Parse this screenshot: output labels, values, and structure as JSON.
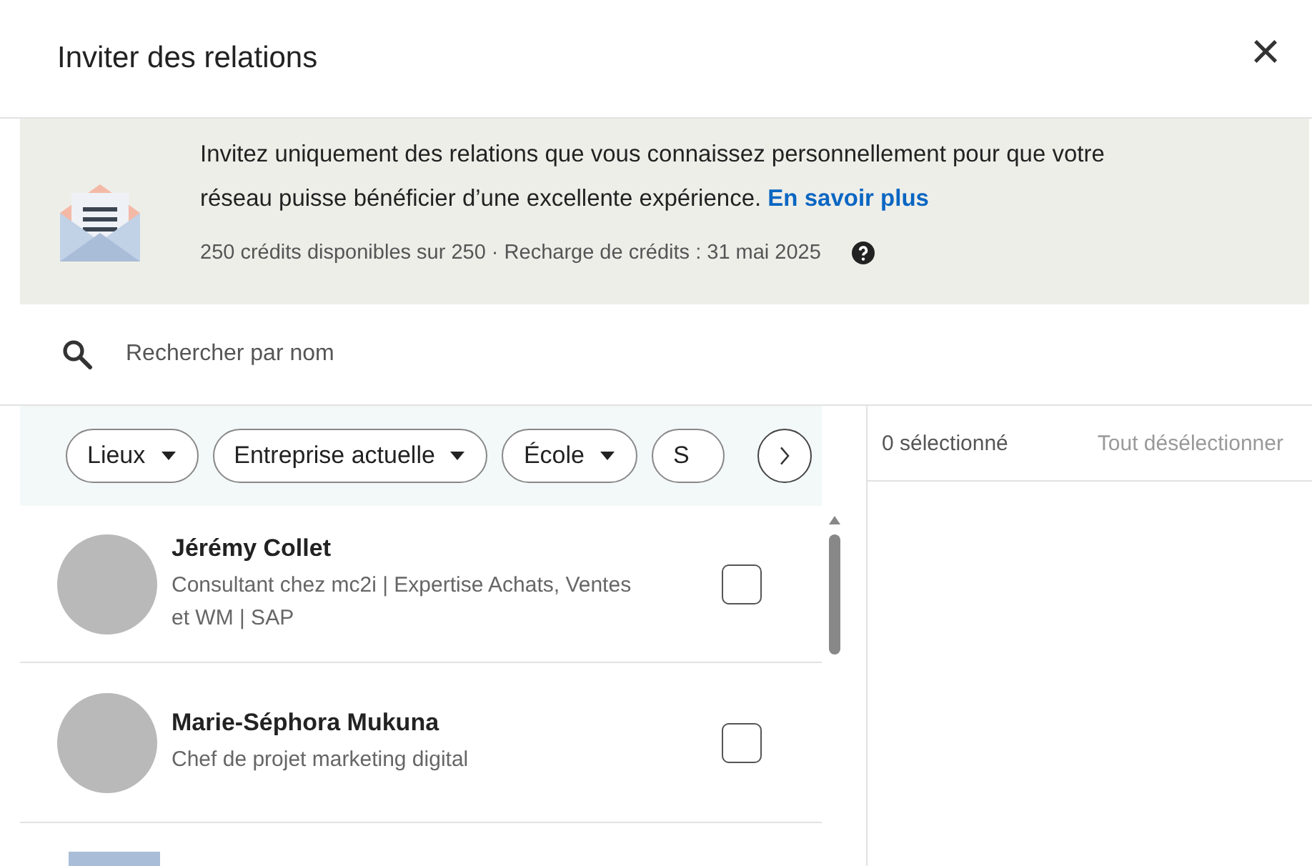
{
  "dialog": {
    "title": "Inviter des relations",
    "close": "×"
  },
  "notice": {
    "text": "Invitez uniquement des relations que vous connaissez personnellement pour que votre réseau puisse bénéficier d’une excellente expérience.",
    "link": "En savoir plus",
    "credits": "250 crédits disponibles sur 250 · Recharge de crédits : 31 mai 2025"
  },
  "search": {
    "placeholder": "Rechercher par nom"
  },
  "filters": [
    {
      "label": "Lieux",
      "dropdown": true
    },
    {
      "label": "Entreprise actuelle",
      "dropdown": true
    },
    {
      "label": "École",
      "dropdown": true
    },
    {
      "label": "S",
      "dropdown": false
    }
  ],
  "selection": {
    "count": "0 sélectionné",
    "clear": "Tout désélectionner"
  },
  "people": [
    {
      "name": "Jérémy Collet",
      "headline": "Consultant chez mc2i | Expertise Achats, Ventes et WM | SAP",
      "checked": false
    },
    {
      "name": "Marie-Séphora Mukuna",
      "headline": "Chef de projet marketing digital",
      "checked": false
    }
  ]
}
